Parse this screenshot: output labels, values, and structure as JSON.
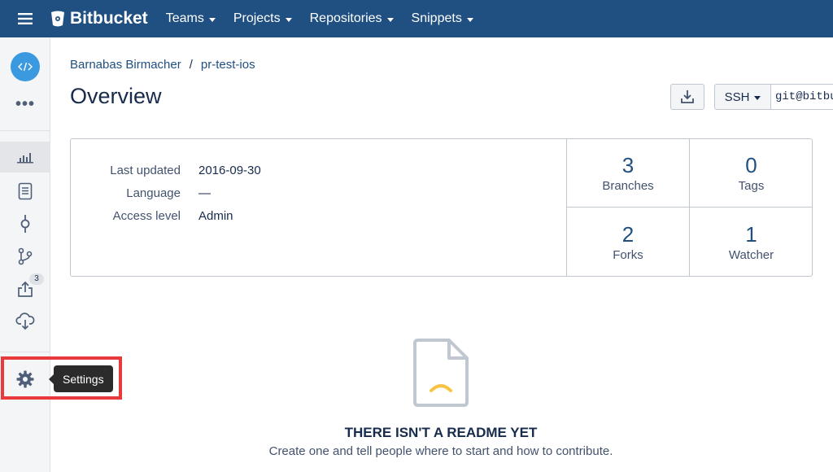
{
  "topbar": {
    "logo_text": "Bitbucket",
    "nav": [
      {
        "label": "Teams"
      },
      {
        "label": "Projects"
      },
      {
        "label": "Repositories"
      },
      {
        "label": "Snippets"
      }
    ]
  },
  "sidebar": {
    "more_label": "•••",
    "pull_requests_badge": "3",
    "tooltip": "Settings"
  },
  "breadcrumb": {
    "owner": "Barnabas Birmacher",
    "separator": "/",
    "repo": "pr-test-ios"
  },
  "page": {
    "title": "Overview"
  },
  "clone": {
    "protocol": "SSH",
    "url": "git@bitbucket.org"
  },
  "overview": {
    "meta": [
      {
        "key": "Last updated",
        "value": "2016-09-30"
      },
      {
        "key": "Language",
        "value": "—"
      },
      {
        "key": "Access level",
        "value": "Admin"
      }
    ],
    "stats": [
      {
        "num": "3",
        "label": "Branches"
      },
      {
        "num": "0",
        "label": "Tags"
      },
      {
        "num": "2",
        "label": "Forks"
      },
      {
        "num": "1",
        "label": "Watcher"
      }
    ]
  },
  "readme": {
    "title": "THERE ISN'T A README YET",
    "subtitle": "Create one and tell people where to start and how to contribute."
  },
  "colors": {
    "nav_bg": "#205081",
    "link": "#205081",
    "avatar": "#3b99e0",
    "highlight": "#e8393d",
    "readme_accent": "#f6c342"
  }
}
